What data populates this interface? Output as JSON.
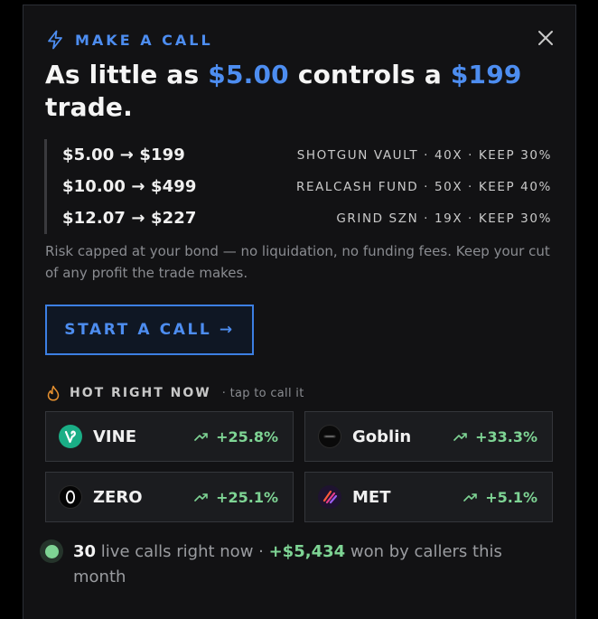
{
  "header": {
    "eyebrow": "MAKE A CALL",
    "headline_prefix": "As little as ",
    "headline_amount": "$5.00",
    "headline_mid": " controls a ",
    "headline_target": "$199",
    "headline_suffix": " trade."
  },
  "icons": {
    "eyebrow": "lightning-bolt-icon",
    "close": "close-icon",
    "hot": "flame-icon",
    "trend": "trending-up-icon"
  },
  "examples": [
    {
      "pair": "$5.00 → $199",
      "meta": "SHOTGUN VAULT · 40X · KEEP 30%"
    },
    {
      "pair": "$10.00 → $499",
      "meta": "REALCASH FUND · 50X · KEEP 40%"
    },
    {
      "pair": "$12.07 → $227",
      "meta": "GRIND SZN · 19X · KEEP 30%"
    }
  ],
  "description": "Risk capped at your bond — no liquidation, no funding fees. Keep your cut of any profit the trade makes.",
  "cta": {
    "label": "START A CALL →"
  },
  "hot": {
    "title": "HOT RIGHT NOW",
    "subtitle": "· tap to call it",
    "tokens": [
      {
        "name": "VINE",
        "change": "+25.8%",
        "icon": "vine-logo-icon"
      },
      {
        "name": "Goblin",
        "change": "+33.3%",
        "icon": "goblin-logo-icon"
      },
      {
        "name": "ZERO",
        "change": "+25.1%",
        "icon": "zero-logo-icon"
      },
      {
        "name": "MET",
        "change": "+5.1%",
        "icon": "met-logo-icon"
      }
    ]
  },
  "footer": {
    "count": "30",
    "count_text": " live calls right now · ",
    "won": "+$5,434",
    "won_text": " won by callers this month"
  },
  "colors": {
    "accent": "#4d8df0",
    "positive": "#7ed494",
    "background": "#121214"
  }
}
